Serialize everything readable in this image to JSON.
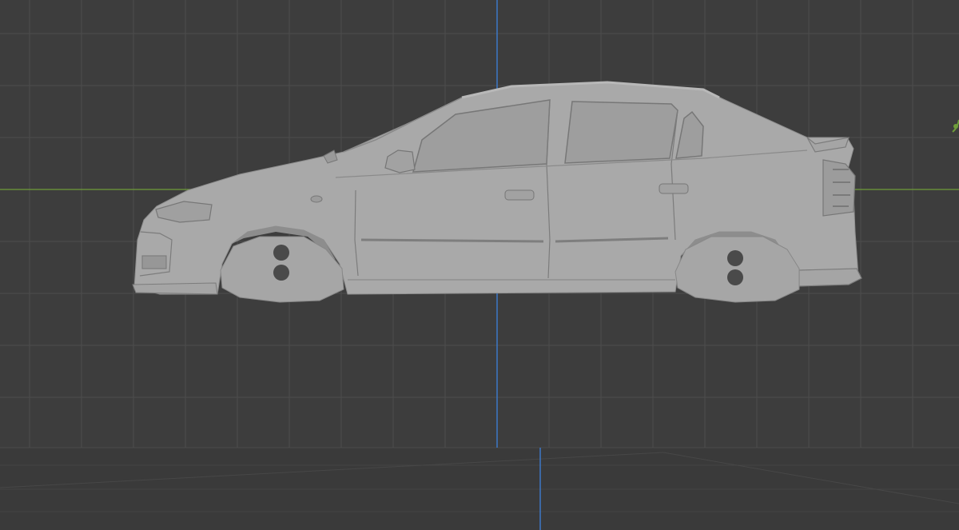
{
  "viewport": {
    "background": "#3d3d3d",
    "grid_minor_color": "#454545",
    "grid_major_color": "#4d4d4d",
    "x_axis_color": "#6f9d3a",
    "z_axis_color": "#3c78c8"
  },
  "model": {
    "body_color": "#a9a9a9",
    "glass_color": "#9e9e9e",
    "shadow_color": "#8c8c8c",
    "line_color": "#6f6f6f",
    "hub_hole_color": "#4a4a4a"
  },
  "gizmo": {
    "icon": "axis-gizmo-icon",
    "color": "#6f9d3a"
  }
}
